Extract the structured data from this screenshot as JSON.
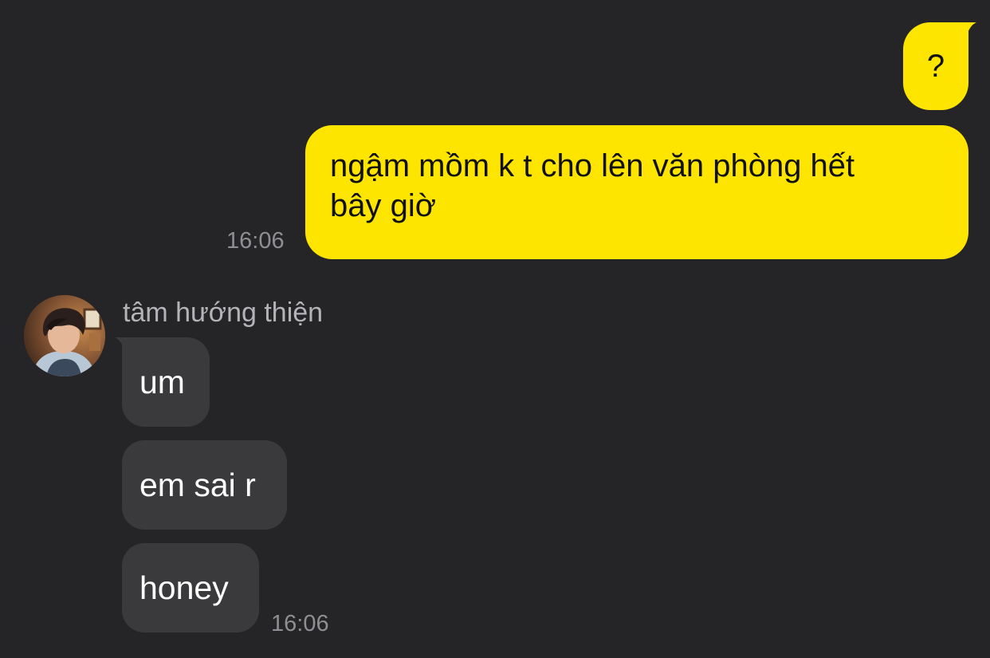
{
  "conversation": {
    "outgoing": [
      {
        "text": "?"
      },
      {
        "text": "ngậm mồm k t cho lên văn phòng hết\nbây giờ",
        "time": "16:06"
      }
    ],
    "incoming": {
      "sender_name": "tâm hướng thiện",
      "messages": [
        {
          "text": "um"
        },
        {
          "text": "em sai r"
        },
        {
          "text": "honey"
        }
      ],
      "time": "16:06"
    }
  },
  "colors": {
    "background": "#252527",
    "outgoing_bubble": "#FEE500",
    "incoming_bubble": "#3a3a3c",
    "timestamp": "#8e8e93",
    "sender_name": "#b4b4b8"
  },
  "icons": {
    "avatar": "profile-photo"
  }
}
